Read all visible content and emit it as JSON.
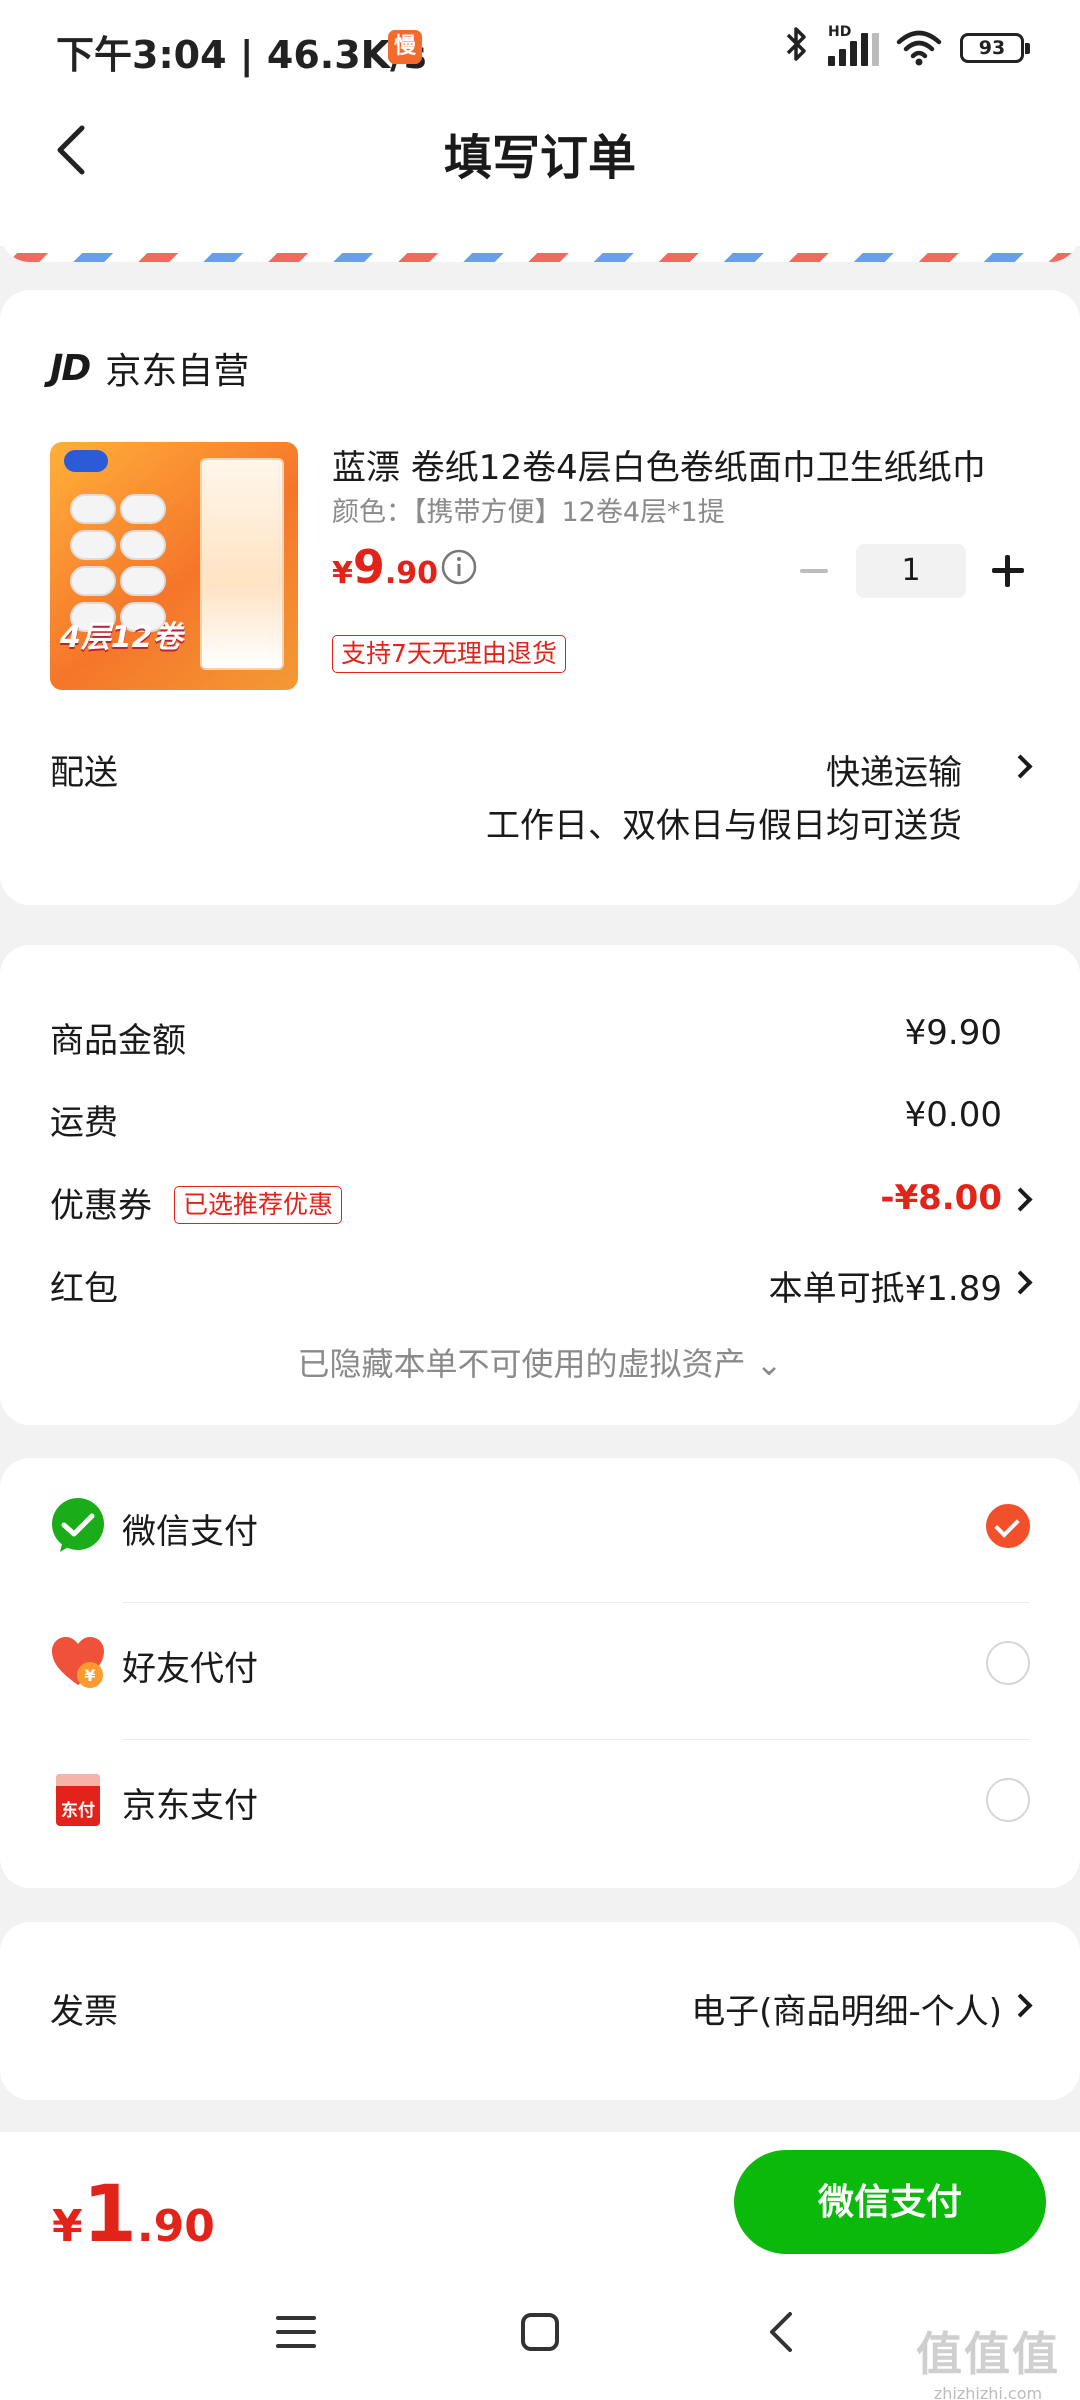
{
  "status_bar": {
    "time": "下午3:04",
    "separator": "|",
    "speed": "46.3K/s",
    "badge": "慢",
    "battery": "93",
    "signal_label": "HD"
  },
  "header": {
    "title": "填写订单",
    "back_icon": "back-chevron-icon"
  },
  "product_card": {
    "store_logo": "JD",
    "store_name": "京东自营",
    "title": "蓝漂 卷纸12卷4层白色卷纸面巾卫生纸纸巾",
    "spec": "颜色：【携带方便】12卷4层*1提",
    "price": {
      "currency": "¥",
      "integer": "9",
      "decimal": ".90"
    },
    "return_tag": "支持7天无理由退货",
    "quantity": "1",
    "image_label": "4层12卷",
    "delivery_label": "配送",
    "delivery_method": "快递运输",
    "delivery_note": "工作日、双休日与假日均可送货"
  },
  "summary": {
    "goods_label": "商品金额",
    "goods_value": "¥9.90",
    "shipping_label": "运费",
    "shipping_value": "¥0.00",
    "coupon_label": "优惠券",
    "coupon_tag": "已选推荐优惠",
    "coupon_value": "-¥8.00",
    "redpack_label": "红包",
    "redpack_value": "本单可抵¥1.89",
    "hidden_assets": "已隐藏本单不可使用的虚拟资产 ⌄"
  },
  "payment": {
    "options": [
      {
        "label": "微信支付",
        "icon": "wechat-pay-icon",
        "selected": true
      },
      {
        "label": "好友代付",
        "icon": "friend-pay-heart-icon",
        "selected": false
      },
      {
        "label": "京东支付",
        "icon": "jd-pay-icon",
        "selected": false
      }
    ],
    "jd_icon_text": "东付"
  },
  "invoice": {
    "label": "发票",
    "value": "电子(商品明细-个人)"
  },
  "bottom": {
    "total": {
      "currency": "¥",
      "integer": "1",
      "decimal": ".90"
    },
    "pay_button": "微信支付"
  },
  "watermark": {
    "big": "值值值",
    "small": "zhizhizhi.com"
  },
  "colors": {
    "accent_red": "#e2231a",
    "wechat_green": "#0bb90b",
    "radio_orange": "#f2502a"
  }
}
